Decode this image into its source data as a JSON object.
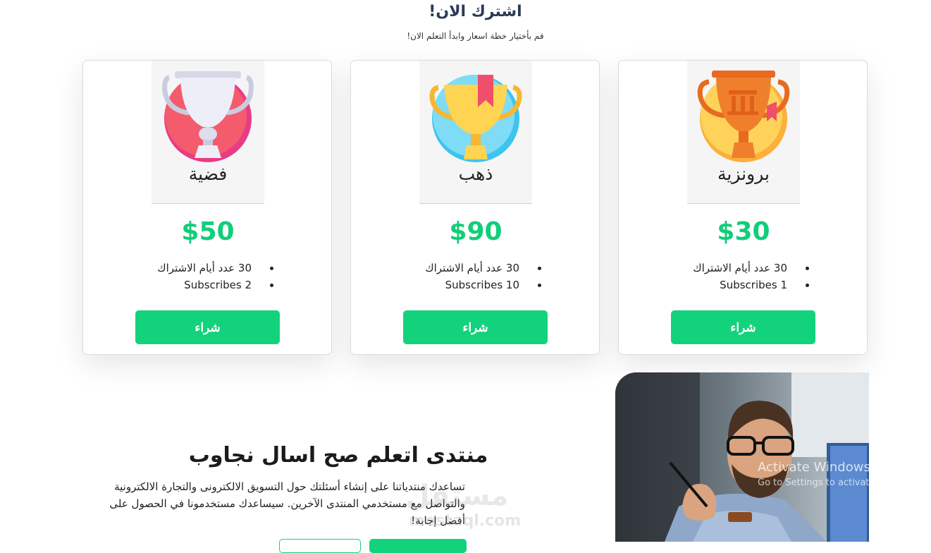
{
  "header": {
    "title": "اشترك الان!",
    "subtitle": "قم بأختيار خطة اسعار وابدأ التعلم الان!"
  },
  "plans": [
    {
      "name": "فضية",
      "price": "$50",
      "features": [
        "30 عدد أيام الاشتراك",
        "Subscribes 2"
      ],
      "button": "شراء",
      "trophy_icon": "silver-trophy-icon",
      "colors": {
        "circle": "#f0487a",
        "cup": "#eaeaf4"
      }
    },
    {
      "name": "ذهب",
      "price": "$90",
      "features": [
        "30 عدد أيام الاشتراك",
        "Subscribes 10"
      ],
      "button": "شراء",
      "trophy_icon": "gold-trophy-icon",
      "colors": {
        "circle": "#5ed3f3",
        "cup": "#ffd04a"
      }
    },
    {
      "name": "برونزية",
      "price": "$30",
      "features": [
        "30 عدد أيام الاشتراك",
        "Subscribes 1"
      ],
      "button": "شراء",
      "trophy_icon": "bronze-trophy-icon",
      "colors": {
        "circle": "#ffcb4f",
        "cup": "#f07f2c"
      }
    }
  ],
  "forum": {
    "title": "منتدى اتعلم صح اسال نجاوب",
    "description": "تساعدك منتدياتنا على إنشاء أسئلتك حول التسويق الالكترونى والتجارة الالكترونية والتواصل مع مستخدمي المنتدى الآخرين. سيساعدك مستخدمونا في الحصول على أفضل إجابة!"
  },
  "watermark": {
    "text": "مستقل",
    "domain": "mostaql.com"
  },
  "os_notice": {
    "title": "Activate Windows",
    "subtitle": "Go to Settings to activate Windows."
  },
  "colors": {
    "accent": "#12d37b",
    "price": "#11ce78",
    "heading": "#2b3a55"
  }
}
